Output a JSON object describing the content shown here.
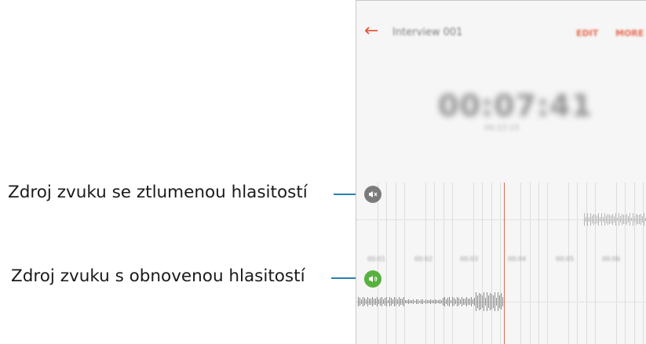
{
  "callouts": {
    "muted": "Zdroj zvuku se ztlumenou hlasitostí",
    "restored": "Zdroj zvuku s obnovenou hlasitostí"
  },
  "phone": {
    "title": "Interview 001",
    "edit_label": "EDIT",
    "more_label": "MORE",
    "time_display": "00:07:41",
    "time_sub": "00:22:15",
    "ticks": [
      "00:01",
      "00:02",
      "00:03",
      "00:04",
      "00:05",
      "00:06"
    ]
  },
  "icons": {
    "back": "back-arrow-icon",
    "muted": "speaker-muted-icon",
    "restored": "speaker-on-icon"
  },
  "colors": {
    "accent": "#e0573e",
    "leader": "#2a7fb8",
    "muted_marker": "#7b7b7b",
    "restored_marker": "#57b13e",
    "playhead": "#e06a5a"
  }
}
